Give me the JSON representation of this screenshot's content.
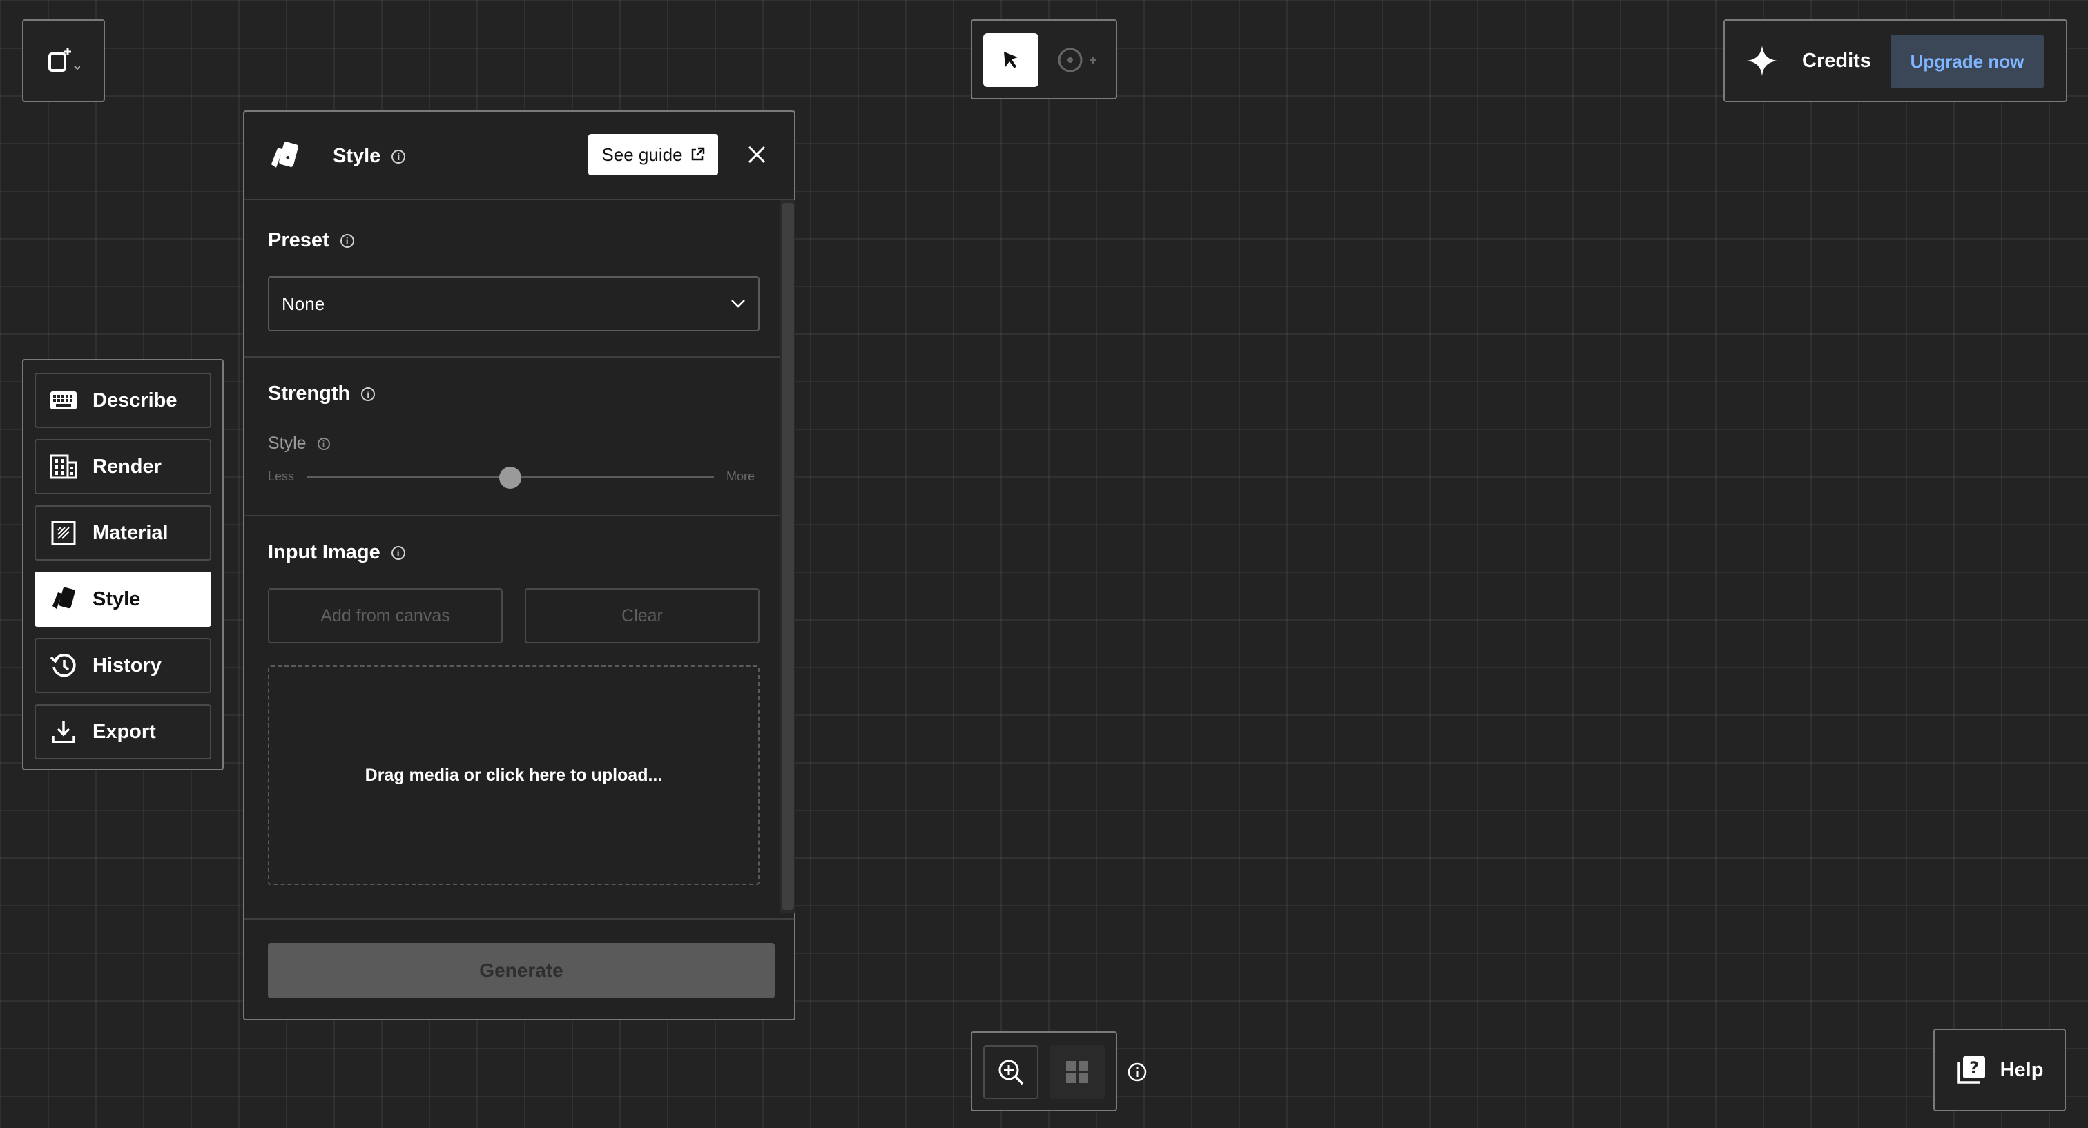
{
  "top_left": {
    "icon": "new-canvas-icon"
  },
  "toolbar": {
    "select_icon": "cursor-arrow-icon",
    "target_icon": "target-add-icon"
  },
  "credits": {
    "label": "Credits",
    "upgrade_label": "Upgrade now",
    "accent": "#7fb6ff",
    "button_bg": "#3b4656"
  },
  "sidebar": {
    "items": [
      {
        "label": "Describe",
        "icon": "keyboard-icon",
        "active": false
      },
      {
        "label": "Render",
        "icon": "building-icon",
        "active": false
      },
      {
        "label": "Material",
        "icon": "material-icon",
        "active": false
      },
      {
        "label": "Style",
        "icon": "style-cards-icon",
        "active": true
      },
      {
        "label": "History",
        "icon": "history-icon",
        "active": false
      },
      {
        "label": "Export",
        "icon": "download-icon",
        "active": false
      }
    ]
  },
  "style_panel": {
    "title": "Style",
    "see_guide_label": "See guide",
    "preset": {
      "label": "Preset",
      "selected": "None"
    },
    "strength": {
      "label": "Strength",
      "slider_label": "Style",
      "min_label": "Less",
      "max_label": "More",
      "value_fraction": 0.5
    },
    "input_image": {
      "label": "Input Image",
      "add_label": "Add from canvas",
      "clear_label": "Clear",
      "dropzone_text": "Drag media or click here to upload..."
    },
    "generate_label": "Generate"
  },
  "bottom": {
    "zoom_icon": "zoom-in-icon",
    "grid_icon": "grid-icon",
    "help_label": "Help"
  }
}
